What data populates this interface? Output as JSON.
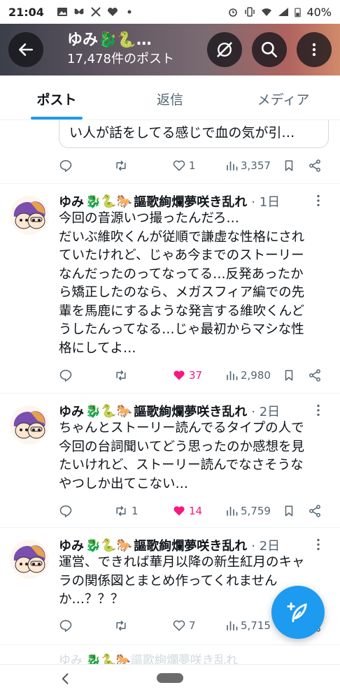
{
  "status_bar": {
    "time": "21:04",
    "battery": "40%",
    "left_icons": [
      "image-icon",
      "butterfly-icon",
      "x-icon",
      "heart-icon",
      "dot-icon"
    ],
    "right_icons": [
      "alarm-icon",
      "vibrate-icon",
      "wifi-icon",
      "signal-icon",
      "battery-icon"
    ]
  },
  "header": {
    "name": "ゆみ🐉🐍…",
    "post_count": "17,478件のポスト"
  },
  "tabs": [
    {
      "label": "ポスト",
      "active": true
    },
    {
      "label": "返信",
      "active": false
    },
    {
      "label": "メディア",
      "active": false
    }
  ],
  "previous_tweet": {
    "quote_text": "い人が話をしてる感じで血の気が引…",
    "retweets": "",
    "likes": "1",
    "views": "3,357"
  },
  "tweets": [
    {
      "name": "ゆみ",
      "name_emoji": "🐉🐍🐎",
      "display_suffix": "謳歌絢爛夢咲き乱れ",
      "time": "· 1日",
      "lines": [
        "今回の音源いつ撮ったんだろ…",
        "だいぶ維吹くんが従順で謙虚な性格にされ",
        "ていたけれど、じゃあ今までのストーリー",
        "なんだったのってなってる…反発あったか",
        "ら矯正したのなら、メガスフィア編での先",
        "輩を馬鹿にするような発言する維吹くんど",
        "うしたんってなる…じゃ最初からマシな性",
        "格にしてよ…"
      ],
      "retweets": "",
      "likes": "37",
      "liked": true,
      "views": "2,980"
    },
    {
      "name": "ゆみ",
      "name_emoji": "🐉🐍🐎",
      "display_suffix": "謳歌絢爛夢咲き乱れ",
      "time": "· 2日",
      "lines": [
        "ちゃんとストーリー読んでるタイプの人で",
        "今回の台詞聞いてどう思ったのか感想を見",
        "たいけれど、ストーリー読んでなさそうな",
        "やつしか出てこない…"
      ],
      "retweets": "1",
      "likes": "14",
      "liked": true,
      "views": "5,759"
    },
    {
      "name": "ゆみ",
      "name_emoji": "🐉🐍🐎",
      "display_suffix": "謳歌絢爛夢咲き乱れ",
      "time": "· 2日",
      "lines": [
        "運営、できれば華月以降の新生紅月のキャ",
        "ラの関係図とまとめ作ってくれません",
        "か…？？？"
      ],
      "retweets": "",
      "likes": "7",
      "liked": false,
      "views": "5,715"
    }
  ],
  "partial_next": "ゆみ 🐉🐍🐎謳歌絢爛夢咲き乱れ",
  "colors": {
    "accent": "#1d9bf0",
    "like": "#f91880",
    "muted": "#536471"
  }
}
